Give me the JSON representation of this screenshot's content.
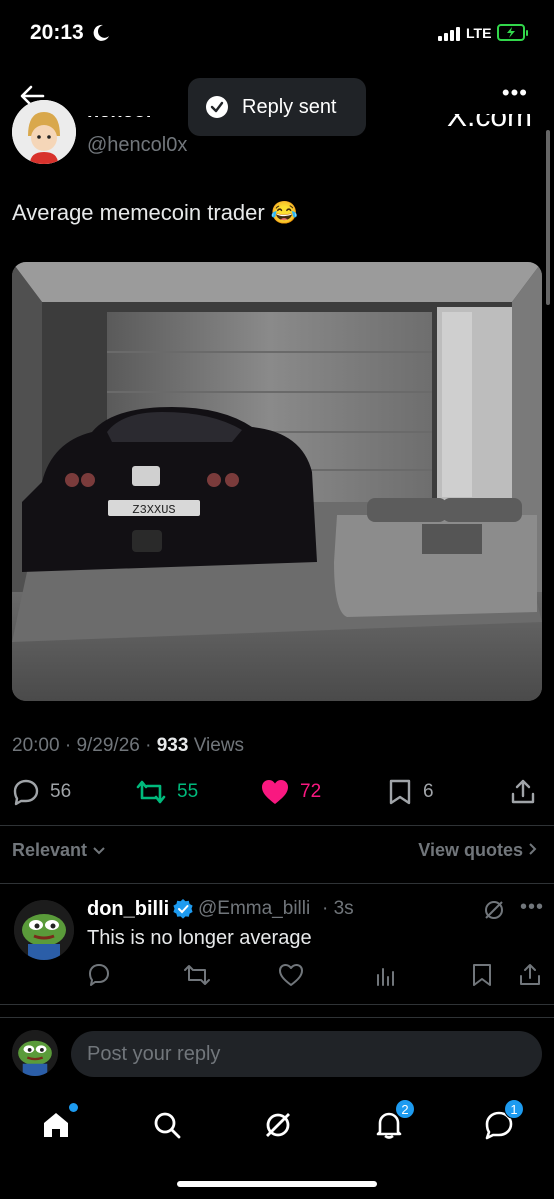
{
  "status_bar": {
    "time": "20:13",
    "network": "LTE"
  },
  "toast": {
    "text": "Reply sent"
  },
  "author": {
    "name": "hencol",
    "handle": "@hencol0x",
    "source": "X.com"
  },
  "tweet": {
    "text": "Average memecoin trader 😂",
    "image_plate": "Z3XXUS",
    "time": "20:00",
    "date": "9/29/26",
    "views_count": "933",
    "views_label": "Views"
  },
  "actions": {
    "replies": "56",
    "reposts": "55",
    "likes": "72",
    "bookmarks": "6"
  },
  "filters": {
    "relevant": "Relevant",
    "view_quotes": "View quotes"
  },
  "reply": {
    "name": "don_billi",
    "handle": "@Emma_billi",
    "time": "3s",
    "text": "This is no longer average"
  },
  "composer": {
    "placeholder": "Post your reply"
  },
  "tab_bar": {
    "notifications_badge": "2",
    "messages_badge": "1"
  },
  "colors": {
    "accent": "#1d9bf0",
    "like": "#f91880",
    "repost": "#00ba7c",
    "muted": "#71767b"
  }
}
